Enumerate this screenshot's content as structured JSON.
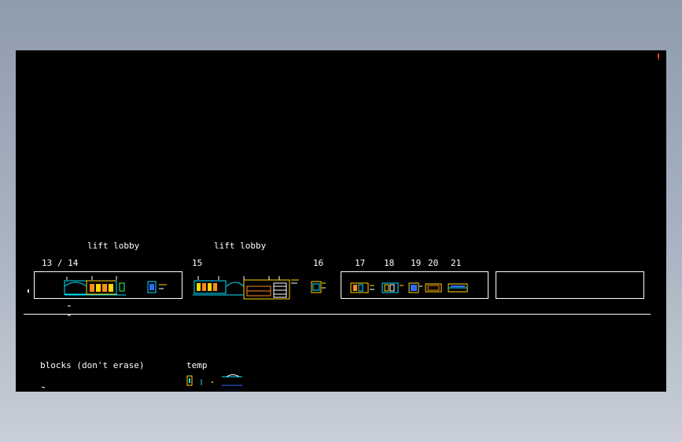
{
  "labels": {
    "lift_lobby_1": "lift lobby",
    "lift_lobby_2": "lift lobby",
    "sheet_13_14": "13 / 14",
    "sheet_15": "15",
    "sheet_16": "16",
    "sheet_17": "17",
    "sheet_18": "18",
    "sheet_19": "19",
    "sheet_20": "20",
    "sheet_21": "21",
    "blocks": "blocks (don't erase)",
    "temp": "temp"
  },
  "colors": {
    "background": "#000000",
    "line": "#ffffff",
    "cyan": "#00e5ff",
    "yellow": "#ffd400",
    "orange": "#ff8c1a",
    "green": "#33ff66",
    "blue": "#2f6bff",
    "red": "#ff3b2f"
  }
}
